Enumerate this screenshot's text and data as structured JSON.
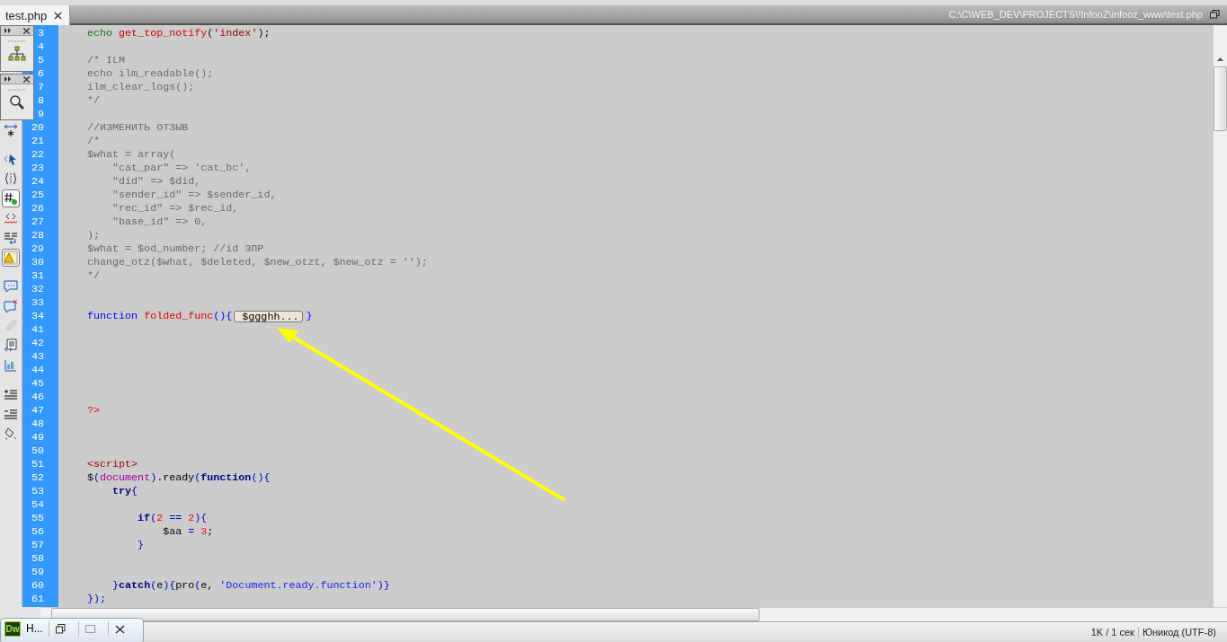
{
  "tab": {
    "label": "test.php",
    "selected": true
  },
  "file_path": "C:\\C\\WEB_DEV\\PROJECTS\\!InfooZ\\infooz_www\\test.php",
  "panels": [
    {
      "kind": "sitemap"
    },
    {
      "kind": "search"
    }
  ],
  "toolbar": [
    {
      "kind": "expand",
      "on": false,
      "disabled": false
    },
    {
      "kind": "select",
      "on": false,
      "disabled": false
    },
    {
      "kind": "braces",
      "on": false,
      "disabled": false
    },
    {
      "kind": "numbers",
      "on": true,
      "disabled": false
    },
    {
      "kind": "invalid",
      "on": false,
      "disabled": false
    },
    {
      "kind": "wrap",
      "on": false,
      "disabled": false
    },
    {
      "kind": "warning",
      "on": true,
      "disabled": false
    },
    {
      "kind": "comment",
      "on": false,
      "disabled": false
    },
    {
      "kind": "uncomment",
      "on": false,
      "disabled": false
    },
    {
      "kind": "pencil",
      "on": false,
      "disabled": true
    },
    {
      "kind": "snippet",
      "on": false,
      "disabled": false
    },
    {
      "kind": "css",
      "on": false,
      "disabled": false
    },
    {
      "kind": "indent",
      "on": false,
      "disabled": false
    },
    {
      "kind": "outdent",
      "on": false,
      "disabled": false
    },
    {
      "kind": "format",
      "on": false,
      "disabled": false
    }
  ],
  "editor": {
    "lines": [
      {
        "n": "3",
        "tokens": [
          {
            "kind": "kw",
            "t": "echo "
          },
          {
            "kind": "fn",
            "t": "get_top_notify"
          },
          {
            "kind": "pl",
            "t": "("
          },
          {
            "kind": "str",
            "t": "'index'"
          },
          {
            "kind": "pl",
            "t": ");"
          }
        ]
      },
      {
        "n": "4"
      },
      {
        "n": "5",
        "tokens": [
          {
            "kind": "cm",
            "t": "/* ILM"
          }
        ]
      },
      {
        "n": "6",
        "tokens": [
          {
            "kind": "cm",
            "t": "echo ilm_readable();"
          }
        ]
      },
      {
        "n": "7",
        "tokens": [
          {
            "kind": "cm",
            "t": "ilm_clear_logs();"
          }
        ]
      },
      {
        "n": "8",
        "tokens": [
          {
            "kind": "cm",
            "t": "*/"
          }
        ]
      },
      {
        "n": "9"
      },
      {
        "n": "20",
        "tokens": [
          {
            "kind": "cm",
            "t": "//ИЗМЕНИТЬ ОТЗЫВ"
          }
        ]
      },
      {
        "n": "21",
        "tokens": [
          {
            "kind": "cm",
            "t": "/*"
          }
        ]
      },
      {
        "n": "22",
        "tokens": [
          {
            "kind": "cm",
            "t": "$what = array("
          }
        ]
      },
      {
        "n": "23",
        "tokens": [
          {
            "kind": "cm",
            "t": "    \"cat_par\" => 'cat_bc',"
          }
        ]
      },
      {
        "n": "24",
        "tokens": [
          {
            "kind": "cm",
            "t": "    \"did\" => $did,"
          }
        ]
      },
      {
        "n": "25",
        "tokens": [
          {
            "kind": "cm",
            "t": "    \"sender_id\" => $sender_id,"
          }
        ]
      },
      {
        "n": "26",
        "tokens": [
          {
            "kind": "cm",
            "t": "    \"rec_id\" => $rec_id,"
          }
        ]
      },
      {
        "n": "27",
        "tokens": [
          {
            "kind": "cm",
            "t": "    \"base_id\" => 0,"
          }
        ]
      },
      {
        "n": "28",
        "tokens": [
          {
            "kind": "cm",
            "t": ");"
          }
        ]
      },
      {
        "n": "29",
        "tokens": [
          {
            "kind": "cm",
            "t": "$what = $od_number; //id ЗПР"
          }
        ]
      },
      {
        "n": "30",
        "tokens": [
          {
            "kind": "cm",
            "t": "change_otz($what, $deleted, $new_otzt, $new_otz = '');"
          }
        ]
      },
      {
        "n": "31",
        "tokens": [
          {
            "kind": "cm",
            "t": "*/"
          }
        ]
      },
      {
        "n": "32"
      },
      {
        "n": "33"
      },
      {
        "n": "34",
        "tokens": [
          {
            "kind": "ph",
            "t": "function "
          },
          {
            "kind": "fn",
            "t": "folded_func"
          },
          {
            "kind": "ph",
            "t": "(){"
          },
          {
            "kind": "fold",
            "t": "$ggghh..."
          },
          {
            "kind": "ph",
            "t": "}"
          }
        ]
      },
      {
        "n": "41"
      },
      {
        "n": "42"
      },
      {
        "n": "43"
      },
      {
        "n": "44"
      },
      {
        "n": "45"
      },
      {
        "n": "46"
      },
      {
        "n": "47",
        "tokens": [
          {
            "kind": "num",
            "t": "?>"
          }
        ]
      },
      {
        "n": "48"
      },
      {
        "n": "49"
      },
      {
        "n": "50"
      },
      {
        "n": "51",
        "tokens": [
          {
            "kind": "tag",
            "t": "<script>"
          }
        ]
      },
      {
        "n": "52",
        "tokens": [
          {
            "kind": "pl",
            "t": "$"
          },
          {
            "kind": "jsp",
            "t": "("
          },
          {
            "kind": "obj",
            "t": "document"
          },
          {
            "kind": "jsp",
            "t": ")"
          },
          {
            "kind": "pl",
            "t": ".ready"
          },
          {
            "kind": "jsp",
            "t": "("
          },
          {
            "kind": "jsk",
            "t": "function"
          },
          {
            "kind": "jsp",
            "t": "(){"
          }
        ]
      },
      {
        "n": "53",
        "tokens": [
          {
            "kind": "jsk",
            "t": "    try"
          },
          {
            "kind": "jsp",
            "t": "{"
          }
        ]
      },
      {
        "n": "54"
      },
      {
        "n": "55",
        "tokens": [
          {
            "kind": "jsk",
            "t": "        if"
          },
          {
            "kind": "jsp",
            "t": "("
          },
          {
            "kind": "num",
            "t": "2"
          },
          {
            "kind": "jsp",
            "t": " == "
          },
          {
            "kind": "num",
            "t": "2"
          },
          {
            "kind": "jsp",
            "t": "){"
          }
        ]
      },
      {
        "n": "56",
        "tokens": [
          {
            "kind": "pl",
            "t": "            $aa "
          },
          {
            "kind": "jsp",
            "t": "= "
          },
          {
            "kind": "num",
            "t": "3"
          },
          {
            "kind": "pl",
            "t": ";"
          }
        ]
      },
      {
        "n": "57",
        "tokens": [
          {
            "kind": "jsp",
            "t": "        }"
          }
        ]
      },
      {
        "n": "58"
      },
      {
        "n": "59"
      },
      {
        "n": "60",
        "tokens": [
          {
            "kind": "jsp",
            "t": "    }"
          },
          {
            "kind": "jsk",
            "t": "catch"
          },
          {
            "kind": "jsp",
            "t": "("
          },
          {
            "kind": "pl",
            "t": "e"
          },
          {
            "kind": "jsp",
            "t": "){"
          },
          {
            "kind": "pl",
            "t": "pro"
          },
          {
            "kind": "jsp",
            "t": "("
          },
          {
            "kind": "pl",
            "t": "e, "
          },
          {
            "kind": "jstr",
            "t": "'Document.ready.function'"
          },
          {
            "kind": "jsp",
            "t": ")}"
          }
        ]
      },
      {
        "n": "61",
        "tokens": [
          {
            "kind": "jsp",
            "t": "});"
          }
        ]
      }
    ]
  },
  "status_bar": {
    "size_time": "1K / 1 сек",
    "encoding": "Юникод (UTF-8)"
  },
  "taskbar_thumbnail": {
    "badge": "Dw",
    "label": "H..."
  }
}
